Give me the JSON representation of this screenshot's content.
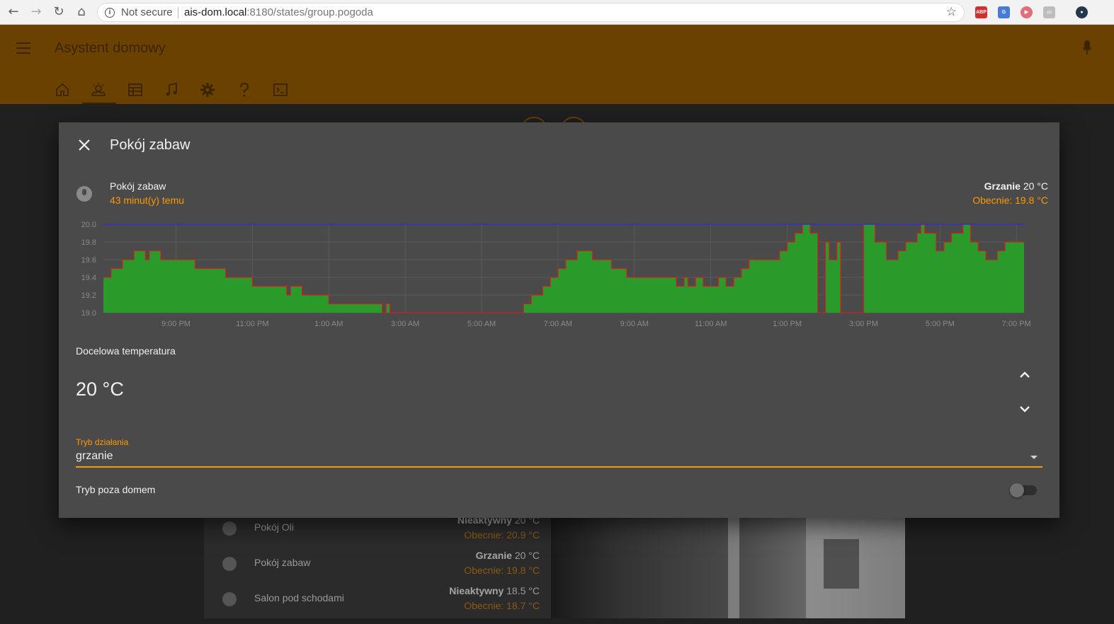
{
  "browser": {
    "security_label": "Not secure",
    "url_host": "ais-dom.local",
    "url_rest": ":8180/states/group.pogoda",
    "ext_abp": "ABP"
  },
  "header": {
    "title": "Asystent domowy",
    "tabs": [
      "home-icon",
      "weather-icon",
      "table-icon",
      "music-icon",
      "settings-icon",
      "help-icon",
      "terminal-icon"
    ],
    "selected_tab": 1,
    "color": "#6b4100"
  },
  "background_list": [
    {
      "name": "Pokój Oli",
      "state_bold": "Nieaktywny",
      "state_rest": " 20 °C",
      "current": "Obecnie: 20.9 °C"
    },
    {
      "name": "Pokój zabaw",
      "state_bold": "Grzanie",
      "state_rest": " 20 °C",
      "current": "Obecnie: 19.8 °C"
    },
    {
      "name": "Salon pod schodami",
      "state_bold": "Nieaktywny",
      "state_rest": " 18.5 °C",
      "current": "Obecnie: 18.7 °C"
    }
  ],
  "dialog": {
    "title": "Pokój zabaw",
    "entity": {
      "name": "Pokój zabaw",
      "last_changed": "43 minut(y) temu",
      "state_bold": "Grzanie",
      "state_rest": " 20 °C",
      "current": "Obecnie: 19.8 °C"
    },
    "target_label": "Docelowa temperatura",
    "target_value": "20 °C",
    "mode_label": "Tryb działania",
    "mode_value": "grzanie",
    "away_label": "Tryb poza domem",
    "away_on": false,
    "accent": "#ff9800"
  },
  "chart_data": {
    "type": "area",
    "y_ticks": [
      "19.0",
      "19.2",
      "19.4",
      "19.6",
      "19.8",
      "20.0"
    ],
    "ylim": [
      19.0,
      20.0
    ],
    "x_ticks": [
      "9:00 PM",
      "11:00 PM",
      "1:00 AM",
      "3:00 AM",
      "5:00 AM",
      "7:00 AM",
      "9:00 AM",
      "11:00 AM",
      "1:00 PM",
      "3:00 PM",
      "5:00 PM",
      "7:00 PM"
    ],
    "x_range_hours": [
      19.1,
      43.2
    ],
    "target_series": {
      "color": "#2d2dd0",
      "value": 20.0
    },
    "current_series": {
      "color": "#cc2222",
      "fill": "#2a9a2a",
      "points": [
        [
          19.1,
          19.4
        ],
        [
          19.3,
          19.5
        ],
        [
          19.6,
          19.6
        ],
        [
          19.9,
          19.7
        ],
        [
          20.2,
          19.6
        ],
        [
          20.3,
          19.7
        ],
        [
          20.6,
          19.6
        ],
        [
          21.5,
          19.5
        ],
        [
          22.3,
          19.4
        ],
        [
          23.0,
          19.3
        ],
        [
          23.9,
          19.2
        ],
        [
          24.0,
          19.3
        ],
        [
          24.3,
          19.2
        ],
        [
          25.0,
          19.1
        ],
        [
          26.4,
          19.0
        ],
        [
          26.5,
          19.1
        ],
        [
          26.6,
          19.0
        ],
        [
          30.1,
          19.1
        ],
        [
          30.3,
          19.2
        ],
        [
          30.6,
          19.3
        ],
        [
          30.8,
          19.4
        ],
        [
          31.0,
          19.5
        ],
        [
          31.2,
          19.6
        ],
        [
          31.5,
          19.7
        ],
        [
          31.9,
          19.6
        ],
        [
          32.4,
          19.5
        ],
        [
          32.8,
          19.4
        ],
        [
          34.1,
          19.3
        ],
        [
          34.3,
          19.4
        ],
        [
          34.4,
          19.3
        ],
        [
          34.6,
          19.4
        ],
        [
          34.8,
          19.3
        ],
        [
          35.2,
          19.4
        ],
        [
          35.4,
          19.3
        ],
        [
          35.6,
          19.4
        ],
        [
          35.8,
          19.5
        ],
        [
          36.0,
          19.6
        ],
        [
          36.8,
          19.7
        ],
        [
          37.0,
          19.8
        ],
        [
          37.2,
          19.9
        ],
        [
          37.4,
          20.0
        ],
        [
          37.6,
          19.9
        ],
        [
          37.8,
          19.0
        ],
        [
          38.0,
          19.8
        ],
        [
          38.1,
          19.6
        ],
        [
          38.3,
          19.8
        ],
        [
          38.4,
          19.0
        ],
        [
          39.0,
          20.0
        ],
        [
          39.3,
          19.8
        ],
        [
          39.6,
          19.6
        ],
        [
          39.9,
          19.7
        ],
        [
          40.1,
          19.8
        ],
        [
          40.4,
          19.9
        ],
        [
          40.5,
          20.0
        ],
        [
          40.6,
          19.9
        ],
        [
          40.9,
          19.7
        ],
        [
          41.1,
          19.8
        ],
        [
          41.3,
          19.9
        ],
        [
          41.6,
          20.0
        ],
        [
          41.8,
          19.8
        ],
        [
          42.0,
          19.7
        ],
        [
          42.2,
          19.6
        ],
        [
          42.5,
          19.7
        ],
        [
          42.7,
          19.8
        ],
        [
          43.0,
          19.8
        ]
      ]
    },
    "grid": true
  }
}
